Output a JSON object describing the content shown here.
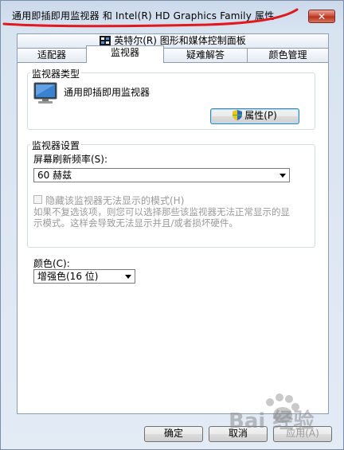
{
  "window": {
    "title": "通用即插即用监视器 和 Intel(R) HD Graphics Family 属性",
    "close_label": "✕"
  },
  "tabs_row1": [
    {
      "label": "英特尔(R) 图形和媒体控制面板",
      "icon": "intel-graphics-icon"
    }
  ],
  "tabs_row2": [
    {
      "label": "适配器"
    },
    {
      "label": "监视器",
      "active": true
    },
    {
      "label": "疑难解答"
    },
    {
      "label": "颜色管理"
    }
  ],
  "monitor_type": {
    "group_label": "监视器类型",
    "monitor_name": "通用即插即用监视器",
    "properties_button": "属性(P)",
    "icon": "monitor-icon",
    "button_icon": "uac-shield-icon"
  },
  "monitor_settings": {
    "group_label": "监视器设置",
    "refresh_label": "屏幕刷新频率(S):",
    "refresh_value": "60 赫兹",
    "hide_modes_label": "隐藏该监视器无法显示的模式(H)",
    "hide_modes_checked": false,
    "description": "如果不复选该项，则您可以选择那些该监视器无法正常显示的显示模式。这样会导致无法显示并且/或者损坏硬件。"
  },
  "color": {
    "label": "颜色(C):",
    "value": "增强色(16 位)"
  },
  "footer": {
    "ok": "确定",
    "cancel": "取消",
    "apply": "应用(A)"
  },
  "watermark": {
    "text": "Bai 经验"
  },
  "colors": {
    "annotation_red": "#e0191f",
    "window_bg": "#dfe8f3"
  }
}
